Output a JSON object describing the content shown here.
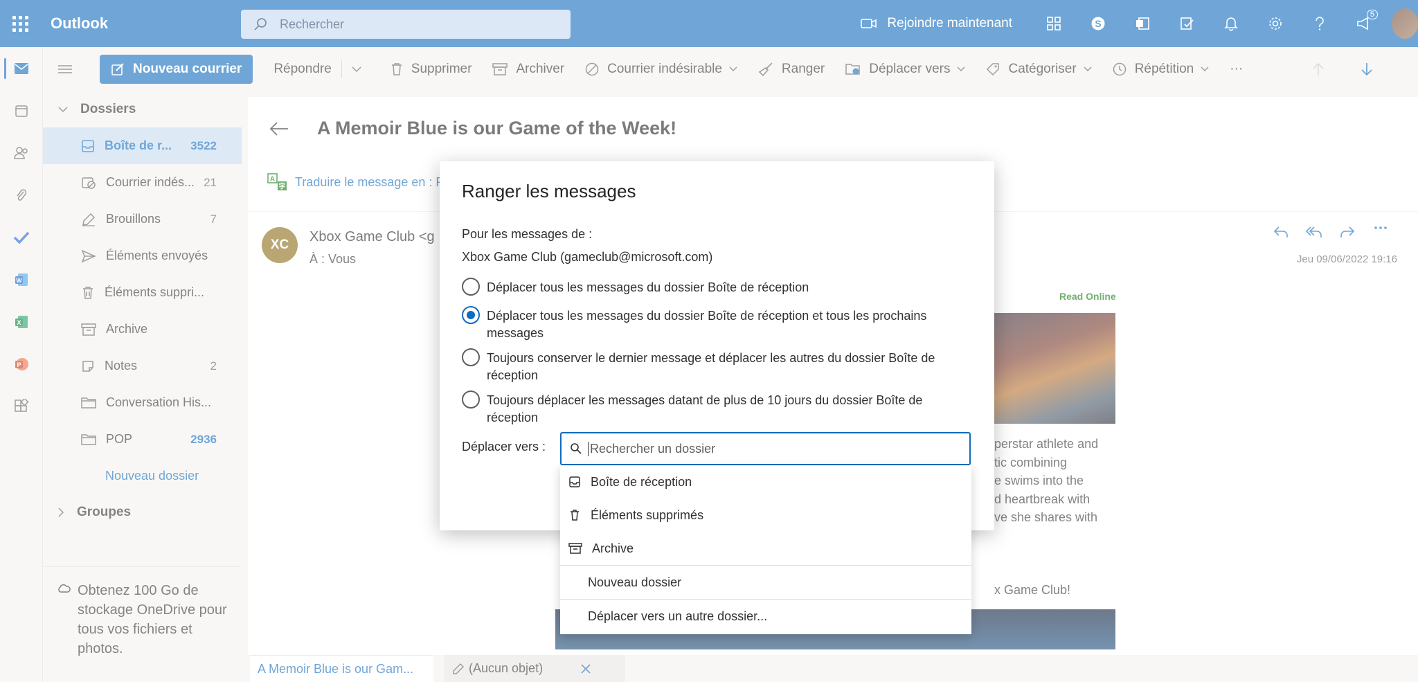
{
  "header": {
    "app_name": "Outlook",
    "search_placeholder": "Rechercher",
    "join_label": "Rejoindre maintenant",
    "notification_count": "5",
    "accent_color": "#0f6cbd"
  },
  "toolbar": {
    "new_mail": "Nouveau courrier",
    "reply": "Répondre",
    "delete": "Supprimer",
    "archive": "Archiver",
    "junk": "Courrier indésirable",
    "sweep": "Ranger",
    "move_to": "Déplacer vers",
    "categorize": "Catégoriser",
    "snooze": "Répétition",
    "more": "···"
  },
  "folders": {
    "section_title": "Dossiers",
    "items": [
      {
        "label": "Boîte de r...",
        "count": "3522",
        "icon": "inbox-icon"
      },
      {
        "label": "Courrier indés...",
        "count": "21",
        "icon": "junk-icon"
      },
      {
        "label": "Brouillons",
        "count": "7",
        "icon": "drafts-icon"
      },
      {
        "label": "Éléments envoyés",
        "count": "",
        "icon": "sent-icon"
      },
      {
        "label": "Éléments suppri...",
        "count": "",
        "icon": "trash-icon"
      },
      {
        "label": "Archive",
        "count": "",
        "icon": "archive-icon"
      },
      {
        "label": "Notes",
        "count": "2",
        "icon": "notes-icon"
      },
      {
        "label": "Conversation His...",
        "count": "",
        "icon": "folder-icon"
      },
      {
        "label": "POP",
        "count": "2936",
        "icon": "folder-icon"
      }
    ],
    "new_folder": "Nouveau dossier",
    "groups_title": "Groupes",
    "onedrive_promo": "Obtenez 100 Go de stockage OneDrive pour tous vos fichiers et photos."
  },
  "message": {
    "subject": "A Memoir Blue is our Game of the Week!",
    "translate": "Traduire le message en : F",
    "sender_initials": "XC",
    "sender_name": "Xbox Game Club <g",
    "to": "À : Vous",
    "date": "Jeu 09/06/2022 19:16",
    "read_online": "Read Online",
    "body_lines": [
      "perstar athlete and",
      "tic combining",
      "e swims into the",
      "d heartbreak with",
      "ve she shares with"
    ],
    "club_line": "x Game Club!"
  },
  "tabs": {
    "tab1": "A Memoir Blue is our Gam...",
    "tab2": "(Aucun objet)"
  },
  "dialog": {
    "title": "Ranger les messages",
    "for_label": "Pour les messages de :",
    "sender": "Xbox Game Club (gameclub@microsoft.com)",
    "options": [
      {
        "label": "Déplacer tous les messages du dossier Boîte de réception",
        "checked": false
      },
      {
        "label": "Déplacer tous les messages du dossier Boîte de réception et tous les prochains messages",
        "checked": true
      },
      {
        "label": "Toujours conserver le dernier message et déplacer les autres du dossier Boîte de réception",
        "checked": false
      },
      {
        "label": "Toujours déplacer les messages datant de plus de 10 jours du dossier Boîte de réception",
        "checked": false
      }
    ],
    "move_to_label": "Déplacer vers :",
    "folder_search_placeholder": "Rechercher un dossier",
    "folder_search_value": ""
  },
  "dropdown": {
    "items": [
      {
        "label": "Boîte de réception",
        "icon": "inbox-icon"
      },
      {
        "label": "Éléments supprimés",
        "icon": "trash-icon"
      },
      {
        "label": "Archive",
        "icon": "archive-icon"
      }
    ],
    "new_folder": "Nouveau dossier",
    "other_folder": "Déplacer vers un autre dossier..."
  }
}
